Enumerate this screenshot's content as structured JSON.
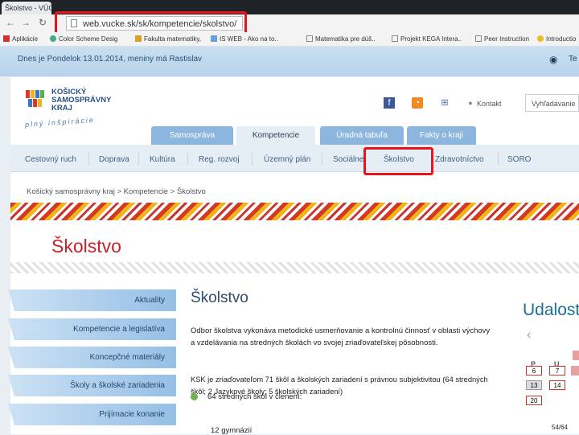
{
  "browser": {
    "tab_title": "Školstvo - VÚCKE",
    "url": "web.vucke.sk/sk/kompetencie/skolstvo/",
    "bookmarks": [
      "Aplikácie",
      "Color Scheme Desig",
      "Fakulta matematiky,",
      "IS WEB - Ako na to..",
      "Matematika pre dúš..",
      "Projekt KEGA Intera..",
      "Peer Instruction",
      "Introductio"
    ]
  },
  "site": {
    "date_line": "Dnes je Pondelok 13.01.2014, meniny má Rastislav",
    "brand_lines": [
      "KOŠICKÝ",
      "SAMOSPRÁVNY",
      "KRAJ"
    ],
    "tagline": "plný inšpirácie",
    "contact": "Kontakt",
    "search_placeholder": "Vyhľadávanie",
    "textsize": "Te",
    "main_tabs": [
      "Samospráva",
      "Kompetencie",
      "Úradná tabuľa",
      "Fakty o kraji"
    ],
    "sub_nav": [
      "Cestovný ruch",
      "Doprava",
      "Kultúra",
      "Reg. rozvoj",
      "Územný plán",
      "Sociálne",
      "Školstvo",
      "Zdravotníctvo",
      "SORO"
    ],
    "breadcrumb": "Košický samosprávny kraj > Kompetencie > Školstvo",
    "page_title": "Školstvo"
  },
  "sidebar": [
    "Aktuality",
    "Kompetencie a legislatíva",
    "Koncepčné materiály",
    "Školy a školské zariadenia",
    "Prijímacie konanie"
  ],
  "content": {
    "title": "Školstvo",
    "para1": "Odbor školstva vykonáva metodické usmerňovanie a kontrolnú činnosť v oblasti výchovy a vzdelávania na stredných školách vo svojej zriaďovateľskej pôsobnosti.",
    "para2": "KSK je zriaďovateľom 71 škôl a školských zariadení s právnou subjektivitou (64 stredných škôl; 2 Jazykové školy; 5 školských zariadení)",
    "bullet": "64 stredných škôl v členení:",
    "sub_item": "12 gymnázií"
  },
  "events": {
    "title": "Udalosti",
    "weekdays": [
      "P",
      "U"
    ],
    "days": [
      "6",
      "7",
      "13",
      "14",
      "20"
    ]
  },
  "slide_counter": "54/64",
  "colors": {
    "accent_red": "#e8141b",
    "title_red": "#c3242b",
    "nav_blue": "#8cb6dd"
  }
}
